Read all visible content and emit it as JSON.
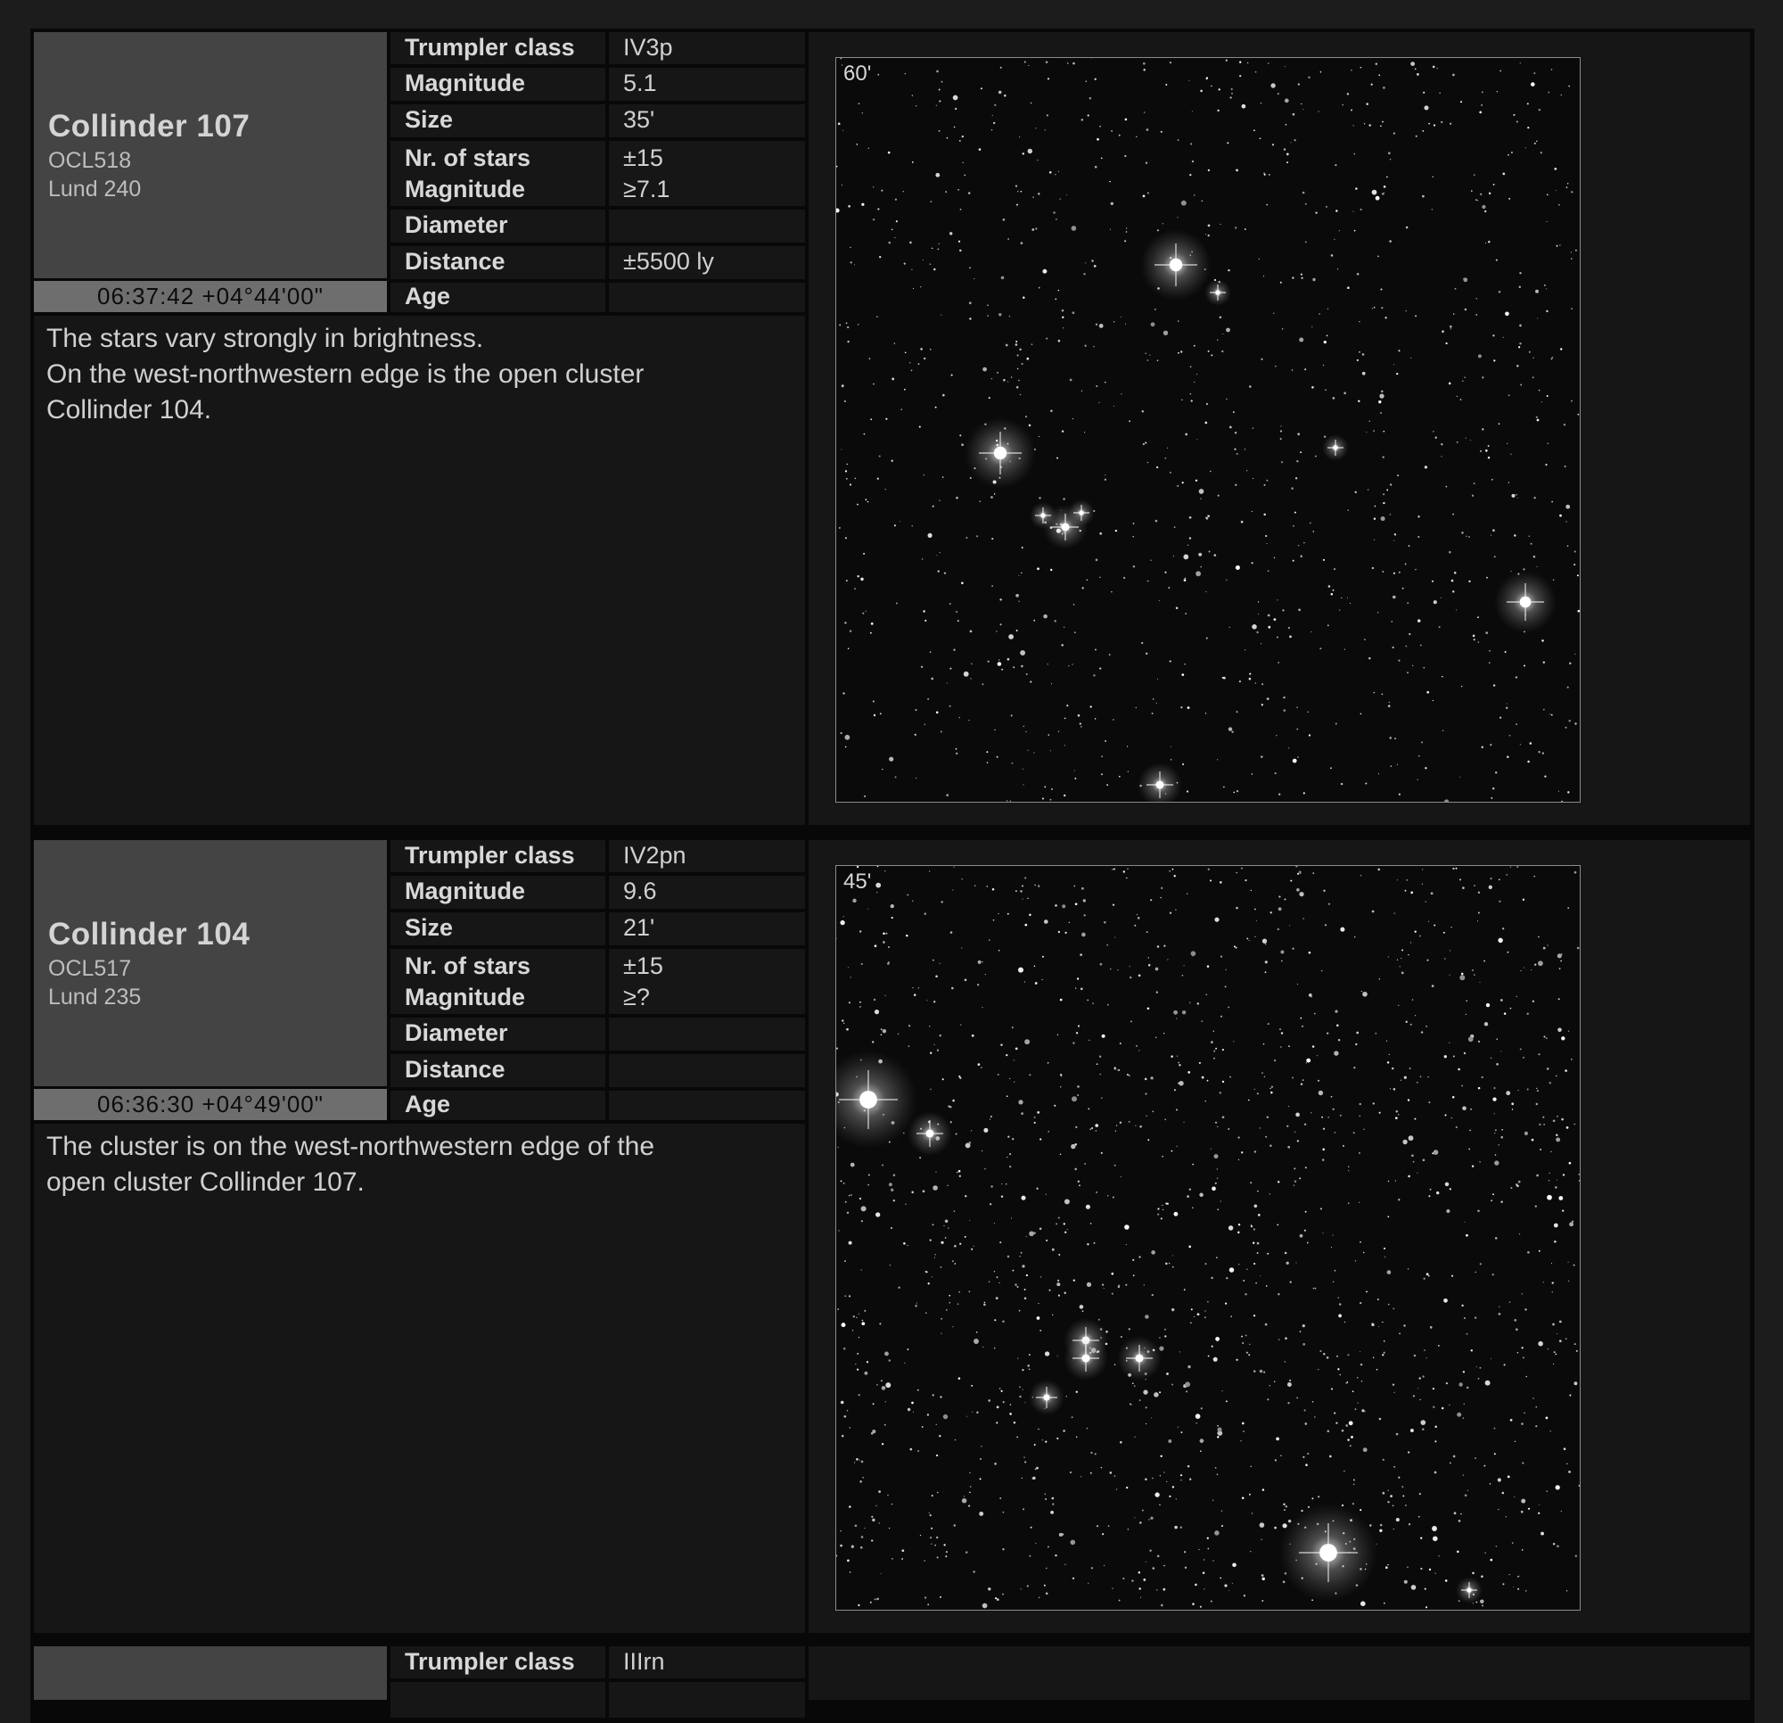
{
  "labels": {
    "trumpler": "Trumpler class",
    "magnitude": "Magnitude",
    "size": "Size",
    "nr_stars": "Nr. of stars",
    "star_magnitude": "Magnitude",
    "diameter": "Diameter",
    "distance": "Distance",
    "age": "Age"
  },
  "entries": [
    {
      "name": "Collinder 107",
      "alt1": "OCL518",
      "alt2": "Lund 240",
      "coords": "06:37:42 +04°44'00\"",
      "trumpler": "IV3p",
      "magnitude": "5.1",
      "size": "35'",
      "nr_stars": "±15",
      "star_magnitude": "≥7.1",
      "diameter": "",
      "distance": "±5500 ly",
      "age": "",
      "description": [
        "The stars vary strongly in brightness.",
        "On the west-northwestern edge is the open cluster",
        "Collinder 104."
      ],
      "fov": "60'"
    },
    {
      "name": "Collinder 104",
      "alt1": "OCL517",
      "alt2": "Lund 235",
      "coords": "06:36:30 +04°49'00\"",
      "trumpler": "IV2pn",
      "magnitude": "9.6",
      "size": "21'",
      "nr_stars": "±15",
      "star_magnitude": "≥?",
      "diameter": "",
      "distance": "",
      "age": "",
      "description": [
        "The cluster is on the west-northwestern edge of the",
        "open cluster Collinder 107."
      ],
      "fov": "45'"
    },
    {
      "trumpler": "IIIrn"
    }
  ]
}
